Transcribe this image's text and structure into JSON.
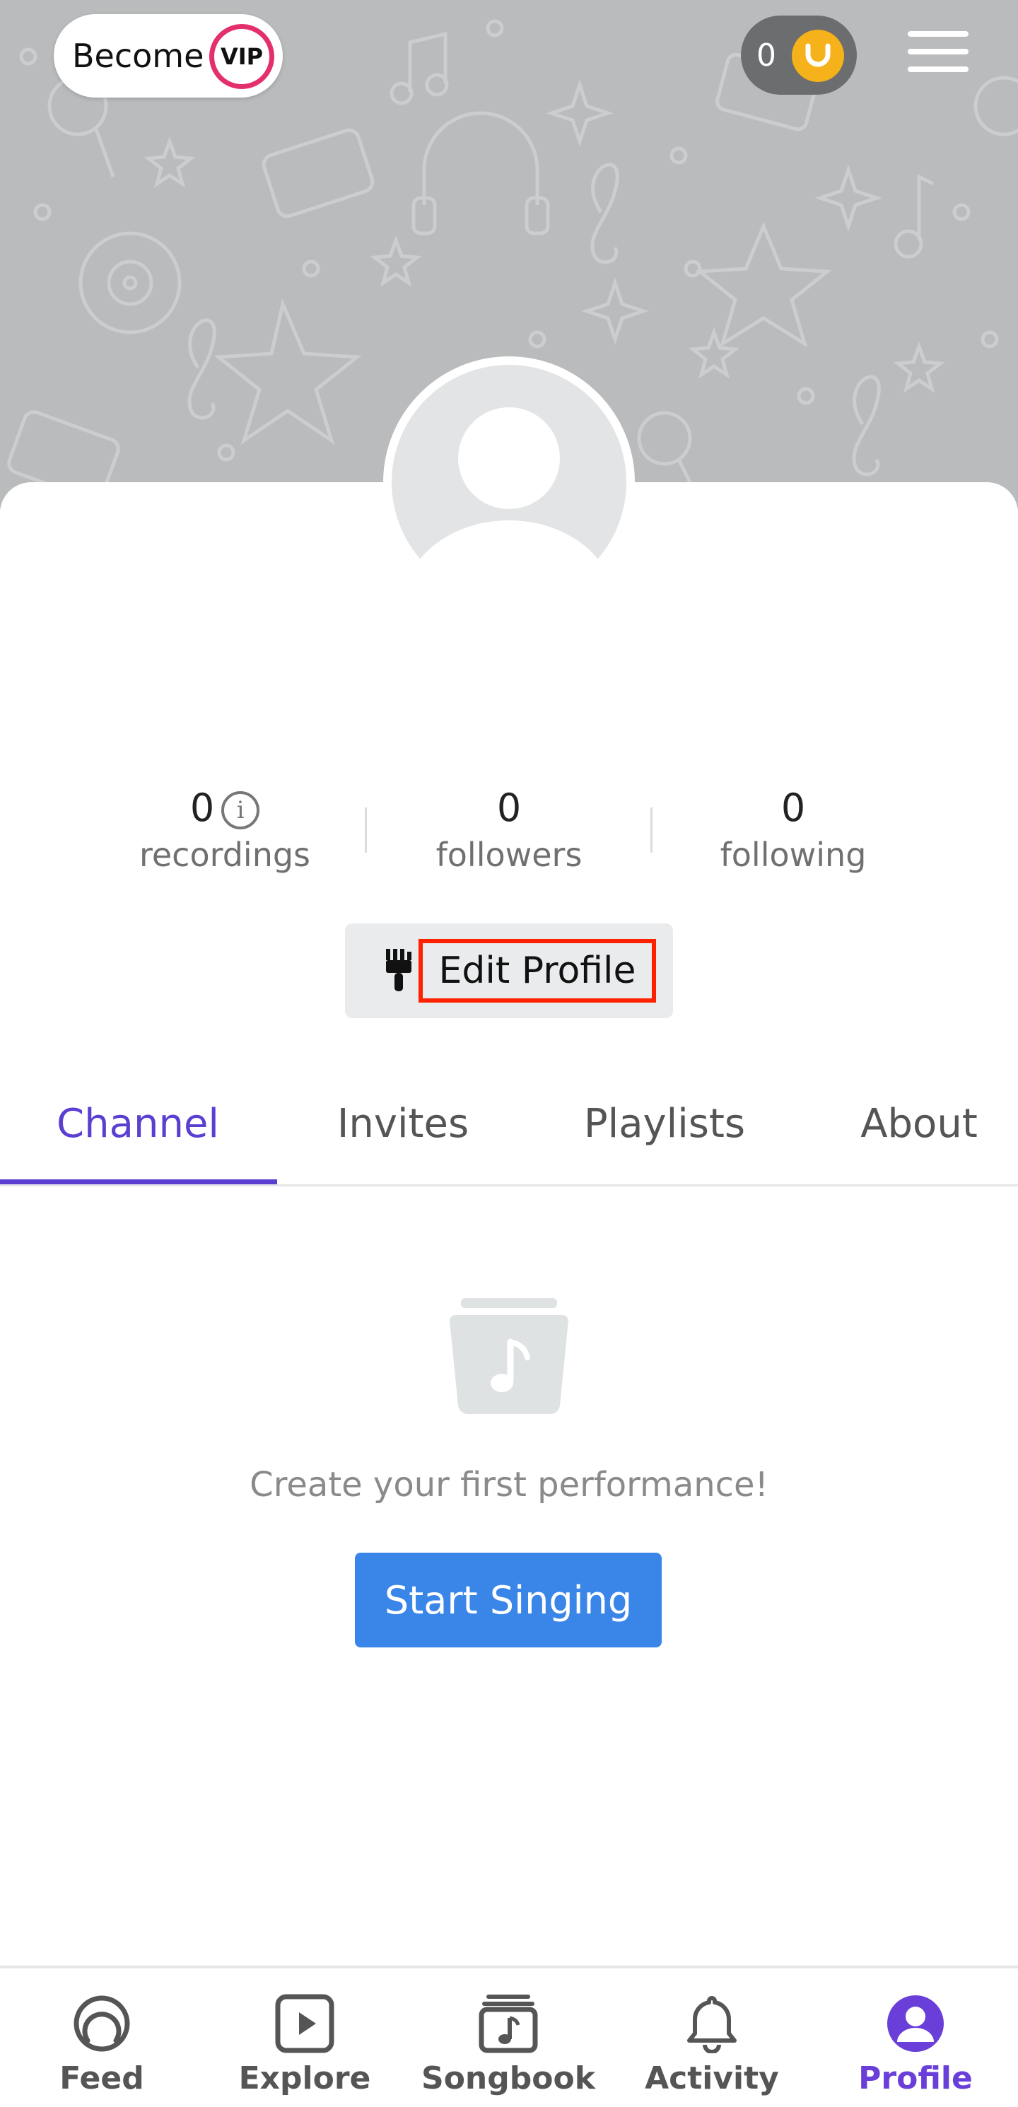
{
  "header": {
    "vip_label": "Become",
    "vip_badge": "VIP",
    "coins": "0",
    "menu_icon": "hamburger-menu-icon"
  },
  "profile": {
    "avatar_icon": "default-avatar-icon"
  },
  "stats": [
    {
      "value": "0",
      "label": "recordings"
    },
    {
      "value": "0",
      "label": "followers"
    },
    {
      "value": "0",
      "label": "following"
    }
  ],
  "edit_profile": {
    "label": "Edit Profile",
    "icon": "paintbrush-icon"
  },
  "tabs": [
    {
      "label": "Channel",
      "active": true
    },
    {
      "label": "Invites",
      "active": false
    },
    {
      "label": "Playlists",
      "active": false
    },
    {
      "label": "About",
      "active": false
    }
  ],
  "empty_state": {
    "icon": "music-folder-icon",
    "message": "Create your first performance!",
    "button": "Start Singing"
  },
  "bottom_nav": [
    {
      "label": "Feed",
      "icon": "feed-icon",
      "active": false
    },
    {
      "label": "Explore",
      "icon": "explore-play-icon",
      "active": false
    },
    {
      "label": "Songbook",
      "icon": "songbook-icon",
      "active": false
    },
    {
      "label": "Activity",
      "icon": "bell-icon",
      "active": false
    },
    {
      "label": "Profile",
      "icon": "profile-icon",
      "active": true
    }
  ],
  "colors": {
    "accent": "#5b3fd1",
    "primary_button": "#3a86e8",
    "vip": "#e3306c",
    "coin": "#f5b21a",
    "highlight_box": "#ff2200"
  }
}
